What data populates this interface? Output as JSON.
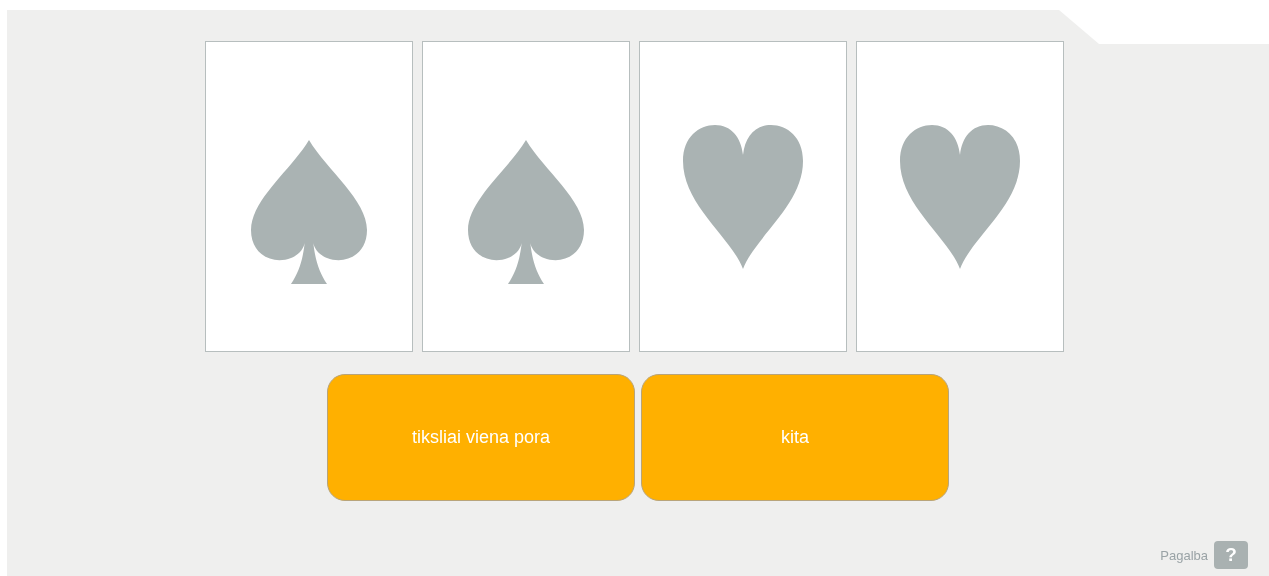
{
  "cards": [
    {
      "kind": "spade"
    },
    {
      "kind": "spade"
    },
    {
      "kind": "heart"
    },
    {
      "kind": "heart"
    }
  ],
  "answers": [
    {
      "label": "tiksliai viena pora"
    },
    {
      "label": "kita"
    }
  ],
  "help": {
    "label": "Pagalba",
    "icon": "?"
  }
}
